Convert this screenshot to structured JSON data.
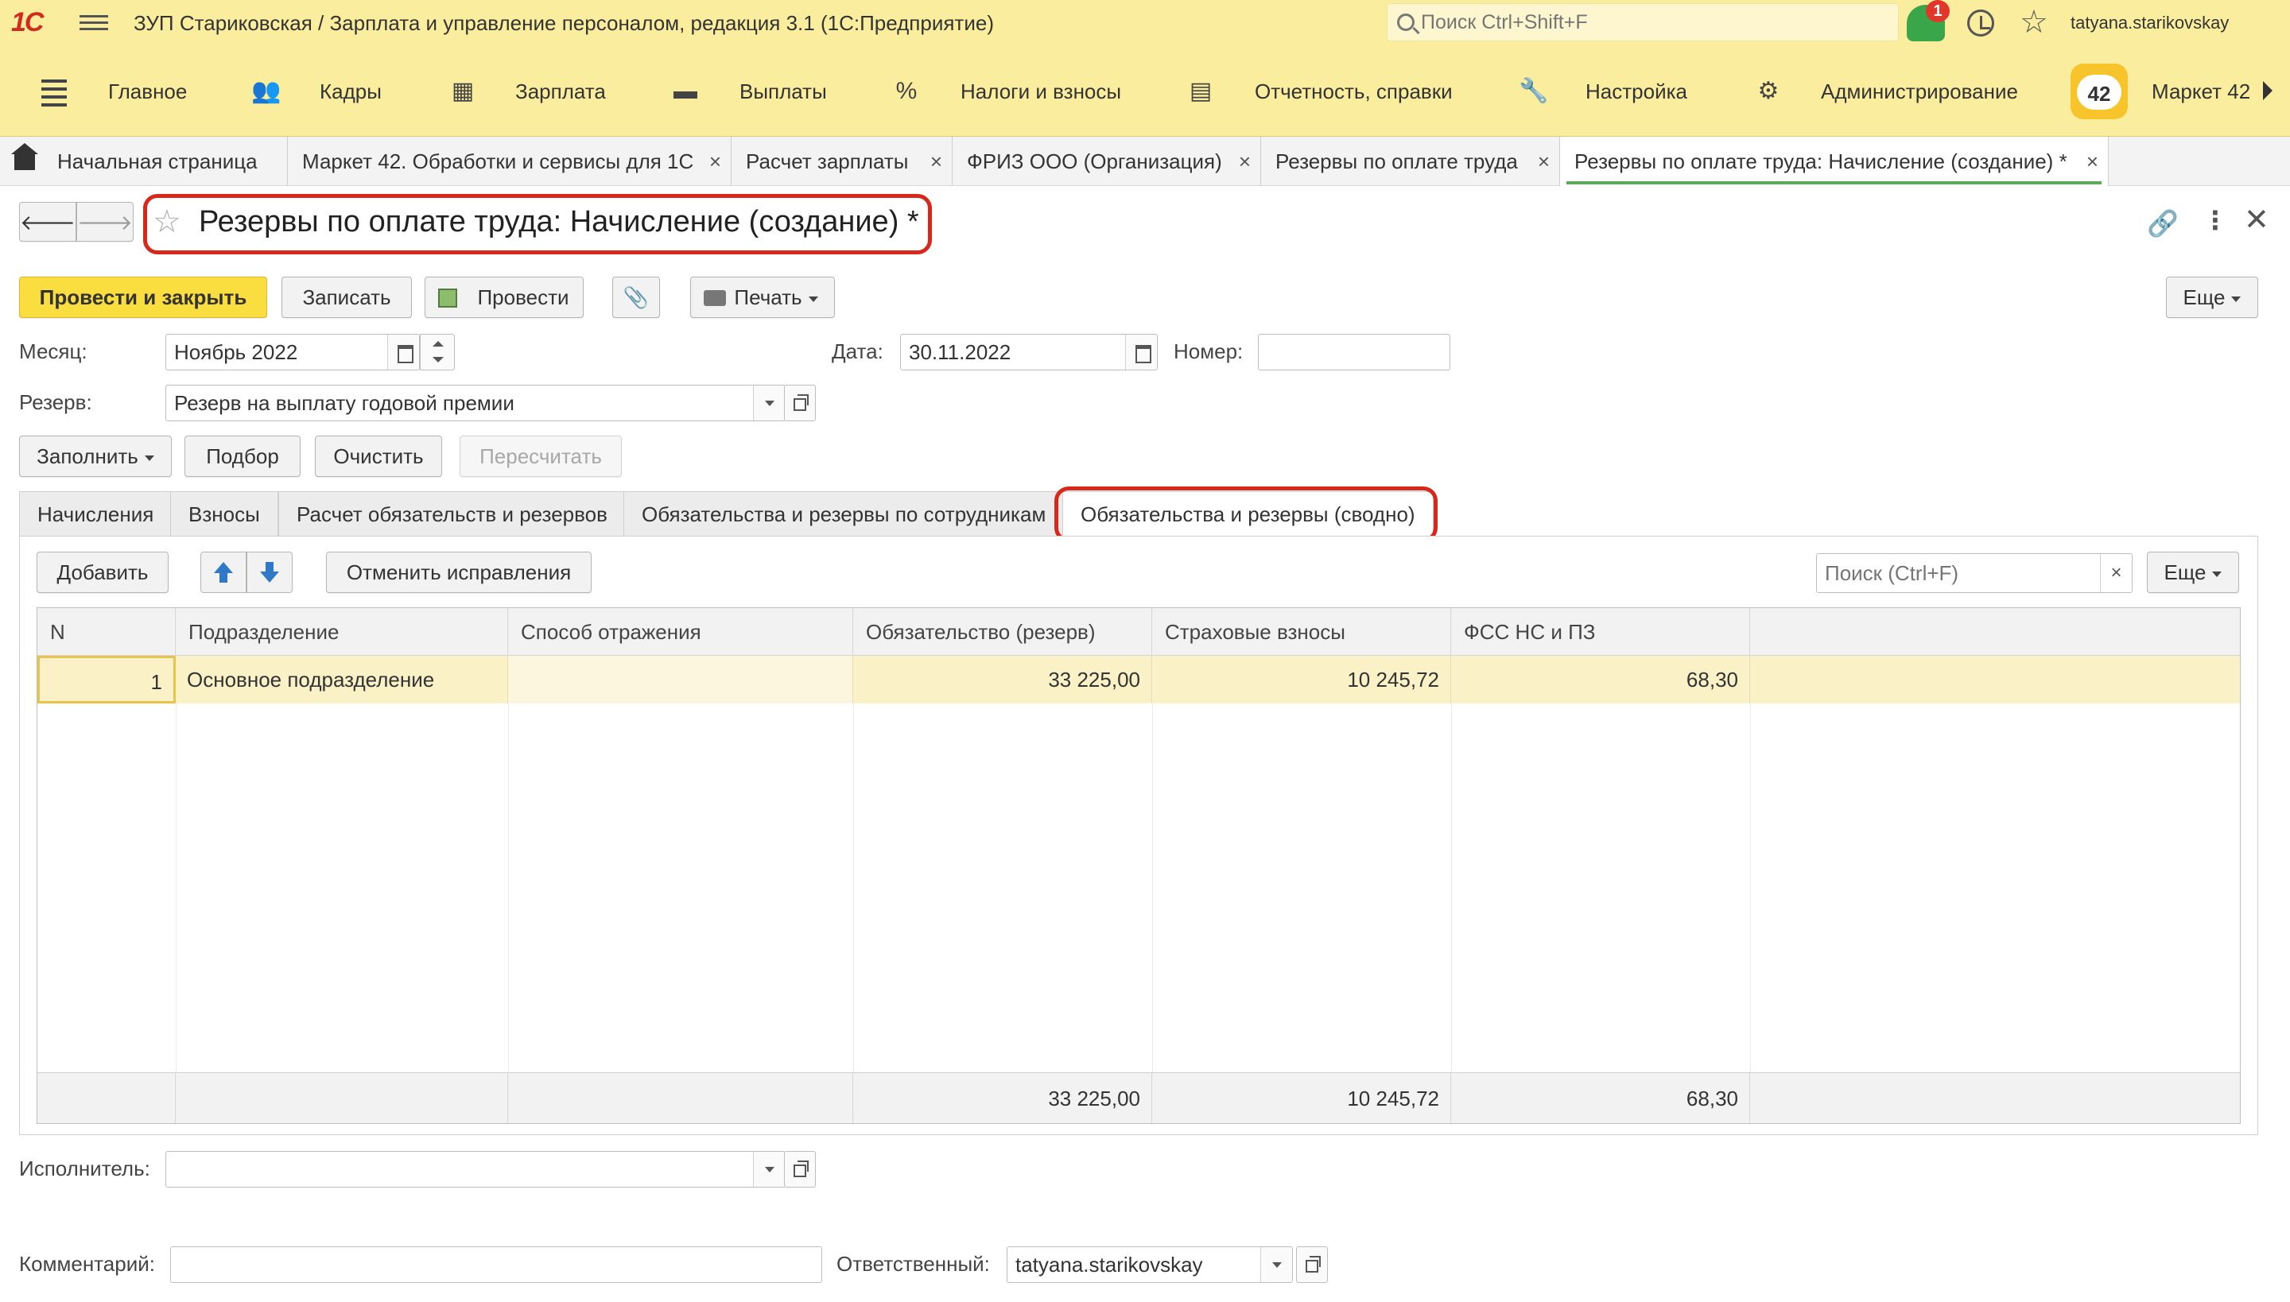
{
  "window": {
    "logo": "1С",
    "title": "ЗУП Стариковская / Зарплата и управление персоналом, редакция 3.1  (1С:Предприятие)",
    "search_placeholder": "Поиск Ctrl+Shift+F",
    "notifications_count": "1",
    "user": "tatyana.starikovskay"
  },
  "sections": [
    {
      "label": "Главное",
      "icon": "menu-icon"
    },
    {
      "label": "Кадры",
      "icon": "people-icon"
    },
    {
      "label": "Зарплата",
      "icon": "calculator-icon"
    },
    {
      "label": "Выплаты",
      "icon": "wallet-icon"
    },
    {
      "label": "Налоги и взносы",
      "icon": "percent-icon"
    },
    {
      "label": "Отчетность, справки",
      "icon": "reports-icon"
    },
    {
      "label": "Настройка",
      "icon": "wrench-icon"
    },
    {
      "label": "Администрирование",
      "icon": "gear-icon"
    },
    {
      "label": "Маркет 42",
      "icon": "market42-icon",
      "badge": "42"
    }
  ],
  "open_tabs": [
    {
      "label": "Начальная страница"
    },
    {
      "label": "Маркет 42. Обработки и сервисы для 1С"
    },
    {
      "label": "Расчет зарплаты"
    },
    {
      "label": "ФРИЗ ООО (Организация)"
    },
    {
      "label": "Резервы по оплате труда"
    },
    {
      "label": "Резервы по оплате труда: Начисление (создание) *"
    }
  ],
  "document": {
    "title": "Резервы по оплате труда: Начисление (создание) *",
    "toolbar": {
      "post_close": "Провести и закрыть",
      "save": "Записать",
      "post": "Провести",
      "print": "Печать",
      "more": "Еще"
    },
    "month_label": "Месяц:",
    "month_value": "Ноябрь 2022",
    "date_label": "Дата:",
    "date_value": "30.11.2022",
    "number_label": "Номер:",
    "number_value": "",
    "reserve_label": "Резерв:",
    "reserve_value": "Резерв на выплату годовой премии",
    "actions": {
      "fill": "Заполнить",
      "select": "Подбор",
      "clear": "Очистить",
      "recalc": "Пересчитать"
    },
    "tabs": [
      "Начисления",
      "Взносы",
      "Расчет обязательств и резервов",
      "Обязательства и резервы по сотрудникам",
      "Обязательства и резервы (сводно)"
    ],
    "grid_toolbar": {
      "add": "Добавить",
      "cancel_corrections": "Отменить исправления",
      "search_placeholder": "Поиск (Ctrl+F)",
      "more": "Еще"
    },
    "columns": [
      "N",
      "Подразделение",
      "Способ отражения",
      "Обязательство (резерв)",
      "Страховые взносы",
      "ФСС НС и ПЗ"
    ],
    "rows": [
      {
        "n": "1",
        "department": "Основное подразделение",
        "method": "",
        "liability": "33 225,00",
        "insurance": "10 245,72",
        "fss": "68,30"
      }
    ],
    "totals": {
      "liability": "33 225,00",
      "insurance": "10 245,72",
      "fss": "68,30"
    },
    "executor_label": "Исполнитель:",
    "executor_value": "",
    "comment_label": "Комментарий:",
    "comment_value": "",
    "responsible_label": "Ответственный:",
    "responsible_value": "tatyana.starikovskay"
  }
}
